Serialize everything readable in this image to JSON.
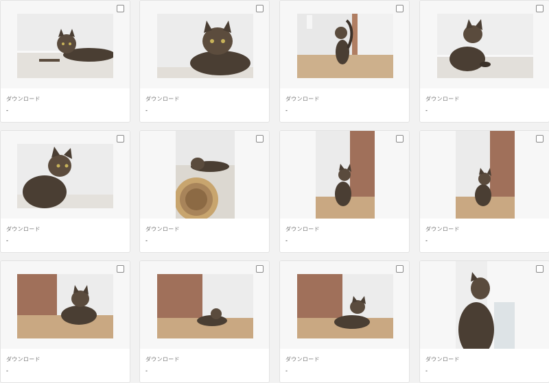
{
  "cards": [
    {
      "download_label": "ダウンロード",
      "download_value": "-",
      "icon": "cat-photo"
    },
    {
      "download_label": "ダウンロード",
      "download_value": "-",
      "icon": "cat-photo"
    },
    {
      "download_label": "ダウンロード",
      "download_value": "-",
      "icon": "cat-photo"
    },
    {
      "download_label": "ダウンロード",
      "download_value": "-",
      "icon": "cat-photo"
    },
    {
      "download_label": "ダウンロード",
      "download_value": "-",
      "icon": "cat-photo"
    },
    {
      "download_label": "ダウンロード",
      "download_value": "-",
      "icon": "cat-photo"
    },
    {
      "download_label": "ダウンロード",
      "download_value": "-",
      "icon": "cat-photo"
    },
    {
      "download_label": "ダウンロード",
      "download_value": "-",
      "icon": "cat-photo"
    },
    {
      "download_label": "ダウンロード",
      "download_value": "-",
      "icon": "cat-photo"
    },
    {
      "download_label": "ダウンロード",
      "download_value": "-",
      "icon": "cat-photo"
    },
    {
      "download_label": "ダウンロード",
      "download_value": "-",
      "icon": "cat-photo"
    },
    {
      "download_label": "ダウンロード",
      "download_value": "-",
      "icon": "cat-photo"
    }
  ],
  "colors": {
    "card_bg": "#ffffff",
    "page_bg": "#f2f2f2",
    "wall": "#e9e9e9",
    "floor_light": "#d9d4cc",
    "wood_floor": "#c9a882",
    "door": "#a0705a",
    "cat_dark": "#3b3129",
    "cat_mid": "#7a6a58"
  }
}
